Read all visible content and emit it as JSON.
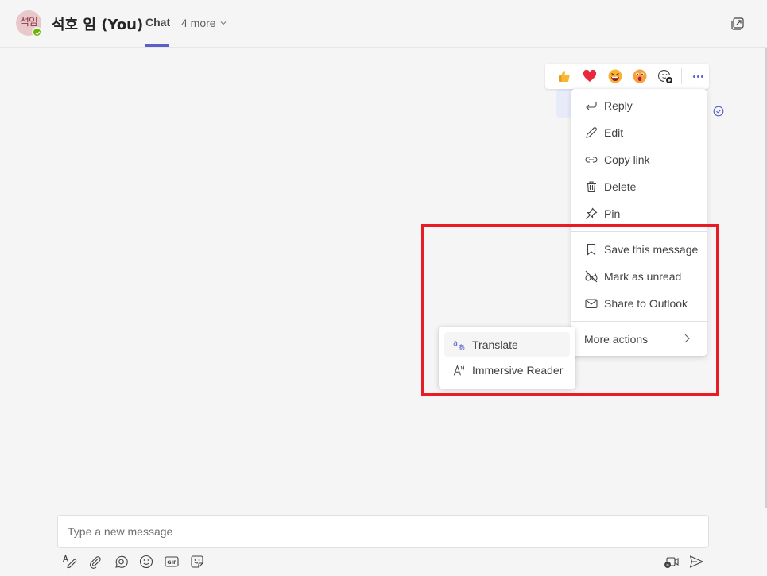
{
  "header": {
    "avatar_initials": "석임",
    "presence_status": "available",
    "title": "석호 임 (You)",
    "tabs": [
      {
        "label": "Chat",
        "active": true
      },
      {
        "label": "4 more",
        "dropdown": true
      }
    ],
    "popout_icon": "popout-icon"
  },
  "colors": {
    "accent": "#5b5fc7",
    "presence": "#6bb700",
    "highlight": "#e81c24",
    "avatar_bg": "#e8c8cb"
  },
  "reactions": [
    {
      "name": "like",
      "glyph": "👍"
    },
    {
      "name": "heart",
      "glyph": "❤️"
    },
    {
      "name": "laugh",
      "glyph": "😆"
    },
    {
      "name": "surprised",
      "glyph": "😮"
    },
    {
      "name": "add-reaction",
      "glyph": ""
    }
  ],
  "message_menu": {
    "items": [
      {
        "label": "Reply",
        "icon": "reply-icon"
      },
      {
        "label": "Edit",
        "icon": "pencil-icon"
      },
      {
        "label": "Copy link",
        "icon": "link-icon"
      },
      {
        "label": "Delete",
        "icon": "trash-icon"
      },
      {
        "label": "Pin",
        "icon": "pin-icon"
      },
      {
        "label": "Save this message",
        "icon": "bookmark-icon"
      },
      {
        "label": "Mark as unread",
        "icon": "unread-icon"
      },
      {
        "label": "Share to Outlook",
        "icon": "mail-icon"
      },
      {
        "label": "More actions",
        "icon": "chevron-right-icon"
      }
    ]
  },
  "submenu": {
    "items": [
      {
        "label": "Translate",
        "icon": "translate-icon"
      },
      {
        "label": "Immersive Reader",
        "icon": "immersive-reader-icon"
      }
    ]
  },
  "compose": {
    "placeholder": "Type a new message",
    "value": ""
  }
}
